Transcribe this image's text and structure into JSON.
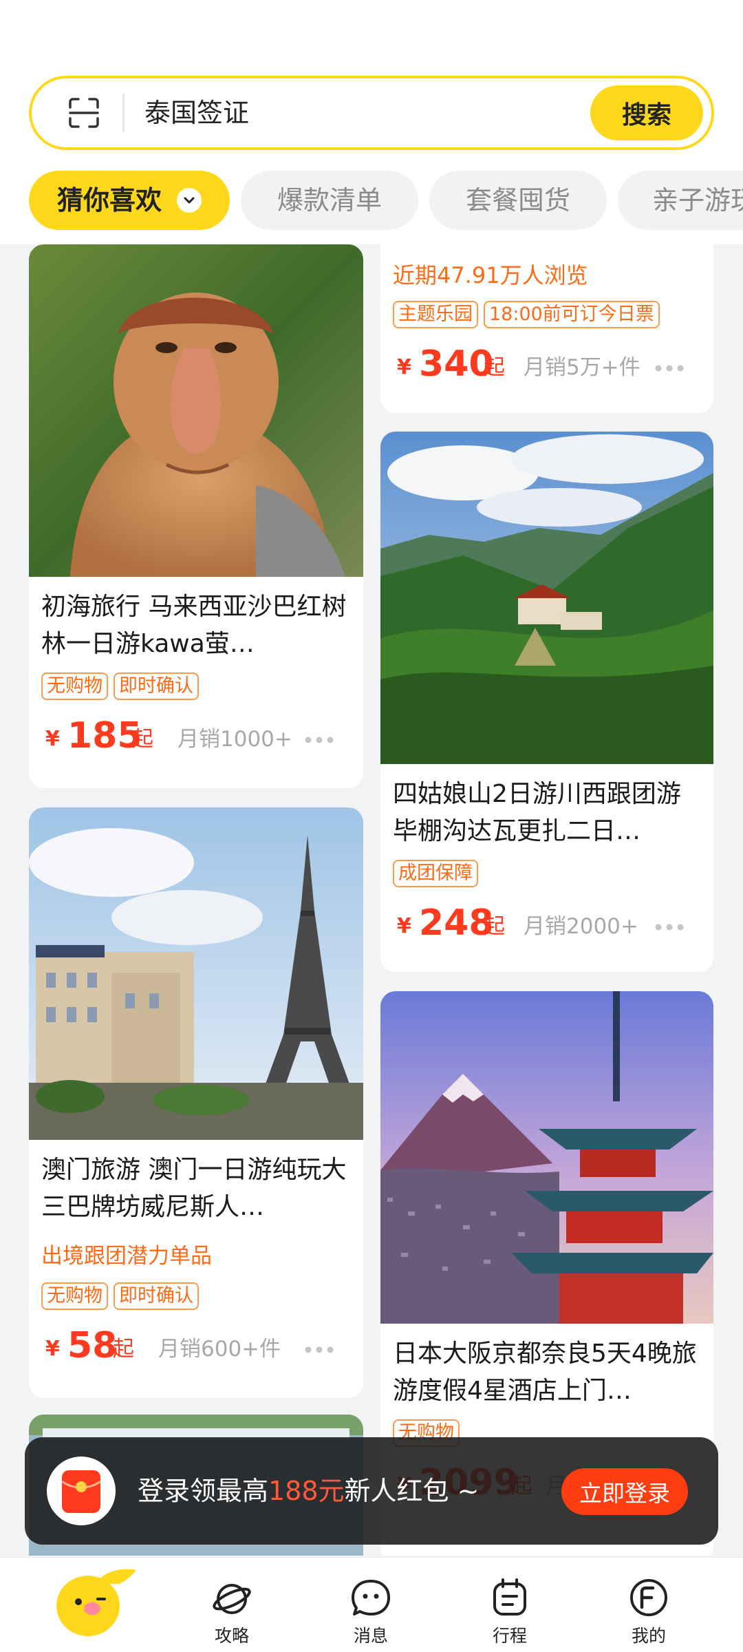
{
  "search": {
    "query": "泰国签证",
    "button_label": "搜索"
  },
  "tabs": [
    {
      "label": "猜你喜欢",
      "active": true
    },
    {
      "label": "爆款清单",
      "active": false
    },
    {
      "label": "套餐囤货",
      "active": false
    },
    {
      "label": "亲子游玩",
      "active": false
    }
  ],
  "cards": [
    {
      "title": "",
      "promo": "近期47.91万人浏览",
      "tags": [
        "主题乐园",
        "18:00前可订今日票"
      ],
      "price": "340",
      "sales": "月销5万+件"
    },
    {
      "image": "proboscis-monkey",
      "title": "初海旅行 马来西亚沙巴红树林一日游kawa萤…",
      "tags": [
        "无购物",
        "即时确认"
      ],
      "price": "185",
      "sales": "月销1000+"
    },
    {
      "image": "mountain-monastery",
      "title": "四姑娘山2日游川西跟团游毕棚沟达瓦更扎二日…",
      "tags": [
        "成团保障"
      ],
      "price": "248",
      "sales": "月销2000+"
    },
    {
      "image": "macau-eiffel-tower",
      "title": "澳门旅游 澳门一日游纯玩大三巴牌坊威尼斯人…",
      "promo": "出境跟团潜力单品",
      "tags": [
        "无购物",
        "即时确认"
      ],
      "price": "58",
      "sales": "月销600+件"
    },
    {
      "image": "mount-fuji-pagoda",
      "title": "日本大阪京都奈良5天4晚旅游度假4星酒店上门…",
      "tags": [
        "无购物"
      ],
      "price": "2099",
      "sales": "月"
    }
  ],
  "common": {
    "yen": "¥",
    "qi": "起"
  },
  "toast": {
    "text_before": "登录领最高",
    "amount": "188元",
    "text_after": "新人红包 ~",
    "button_label": "立即登录"
  },
  "nav": [
    {
      "label": "",
      "icon": "fliggy-logo-icon"
    },
    {
      "label": "攻略",
      "icon": "planet-icon"
    },
    {
      "label": "消息",
      "icon": "message-icon"
    },
    {
      "label": "行程",
      "icon": "itinerary-icon"
    },
    {
      "label": "我的",
      "icon": "profile-icon"
    }
  ],
  "colors": {
    "brand_yellow": "#ffd81c",
    "price_red": "#ff3a1f",
    "tag_orange": "#ff6a16",
    "login_button": "#ff3d10"
  }
}
